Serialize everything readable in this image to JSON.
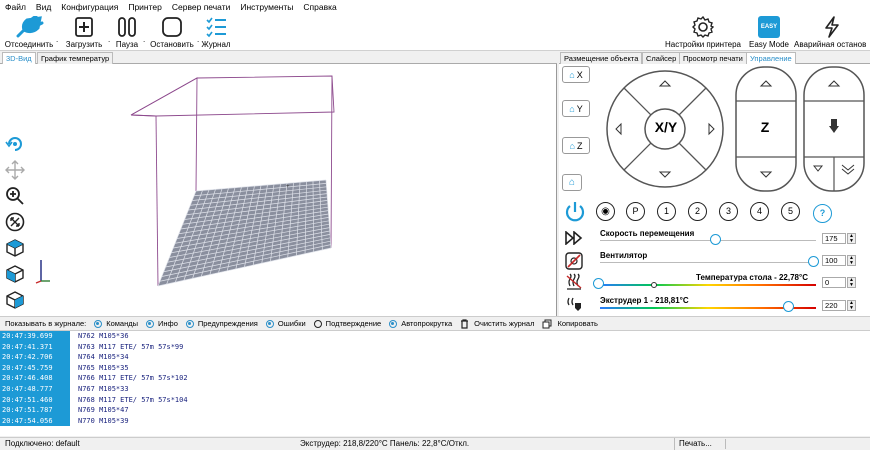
{
  "menu": [
    "Файл",
    "Вид",
    "Конфигурация",
    "Принтер",
    "Сервер печати",
    "Инструменты",
    "Справка"
  ],
  "toolbar": {
    "disconnect": "Отсоединить",
    "load": "Загрузить",
    "pause": "Пауза",
    "stop": "Остановить",
    "log": "Журнал",
    "printer_settings": "Настройки принтера",
    "easy_mode": "Easy Mode",
    "easy_badge": "EASY",
    "emergency": "Аварийная останов"
  },
  "left_tabs": [
    "3D-Вид",
    "График температур"
  ],
  "right_tabs": [
    "Размещение объекта",
    "Слайсер",
    "Просмотр печати",
    "Управление"
  ],
  "control": {
    "home_labels": [
      "X",
      "Y",
      "Z"
    ],
    "xy_label": "X/Y",
    "z_label": "Z",
    "presets": [
      "P",
      "1",
      "2",
      "3",
      "4",
      "5"
    ],
    "help": "?",
    "speed_label": "Скорость перемещения",
    "speed_value": "175",
    "fan_label": "Вентилятор",
    "fan_value": "100",
    "bed_label": "Температура стола - 22,78°C",
    "bed_value": "0",
    "extruder_label": "Экструдер 1 - 218,81°C",
    "extruder_value": "220"
  },
  "logbar": {
    "show_label": "Показывать в журнале:",
    "options": [
      "Команды",
      "Инфо",
      "Предупреждения",
      "Ошибки",
      "Подтверждение",
      "Автопрокрутка"
    ],
    "clear": "Очистить журнал",
    "copy": "Копировать"
  },
  "log": [
    {
      "time": "20:47:39.699",
      "cmd": "N762 M105*36"
    },
    {
      "time": "20:47:41.371",
      "cmd": "N763 M117 ETE/ 57m 57s*99"
    },
    {
      "time": "20:47:42.706",
      "cmd": "N764 M105*34"
    },
    {
      "time": "20:47:45.759",
      "cmd": "N765 M105*35"
    },
    {
      "time": "20:47:46.408",
      "cmd": "N766 M117 ETE/ 57m 57s*102"
    },
    {
      "time": "20:47:48.777",
      "cmd": "N767 M105*33"
    },
    {
      "time": "20:47:51.460",
      "cmd": "N768 M117 ETE/ 57m 57s*104"
    },
    {
      "time": "20:47:51.787",
      "cmd": "N769 M105*47"
    },
    {
      "time": "20:47:54.056",
      "cmd": "N770 M105*39"
    }
  ],
  "status": {
    "connection": "Подключено: default",
    "temps": "Экструдер: 218,8/220°C Панель: 22,8°C/Откл.",
    "printing": "Печать..."
  },
  "colors": {
    "accent": "#1d9ad6",
    "box": "#8e4b8e",
    "bed": "#8a8f9e"
  }
}
